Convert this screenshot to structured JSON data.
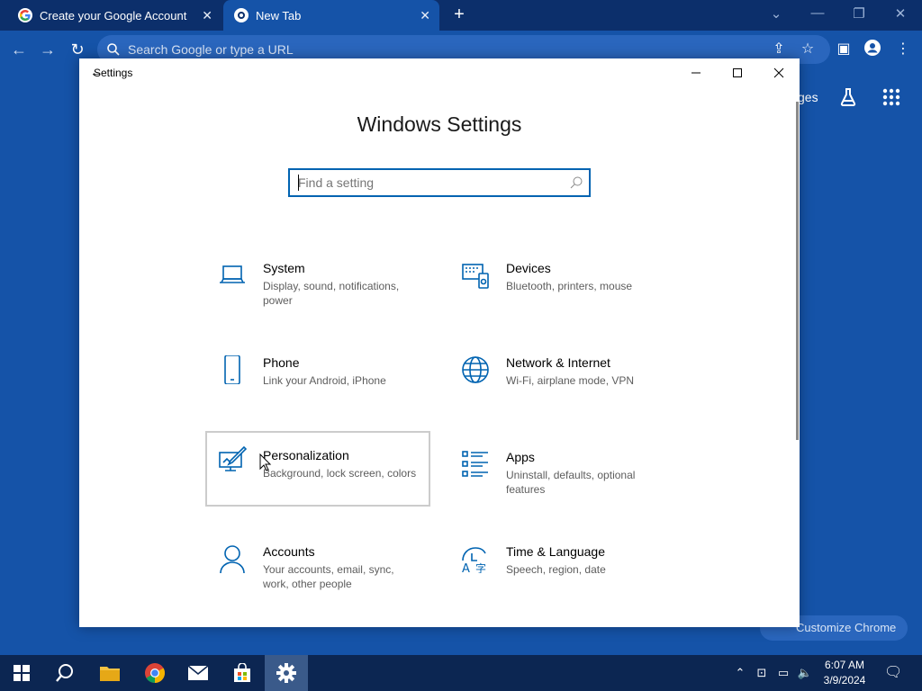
{
  "browser": {
    "tabs": [
      {
        "title": "Create your Google Account"
      },
      {
        "title": "New Tab"
      }
    ],
    "omnibox_placeholder": "Search Google or type a URL",
    "ntp": {
      "images_link": "ges",
      "customize_label": "Customize Chrome"
    }
  },
  "settings": {
    "window_title": "Settings",
    "heading": "Windows Settings",
    "search_placeholder": "Find a setting",
    "tiles": [
      {
        "name": "System",
        "desc": "Display, sound, notifications, power",
        "icon": "laptop-icon"
      },
      {
        "name": "Devices",
        "desc": "Bluetooth, printers, mouse",
        "icon": "devices-icon"
      },
      {
        "name": "Phone",
        "desc": "Link your Android, iPhone",
        "icon": "phone-icon"
      },
      {
        "name": "Network & Internet",
        "desc": "Wi-Fi, airplane mode, VPN",
        "icon": "globe-icon"
      },
      {
        "name": "Personalization",
        "desc": "Background, lock screen, colors",
        "icon": "paint-icon"
      },
      {
        "name": "Apps",
        "desc": "Uninstall, defaults, optional features",
        "icon": "apps-list-icon"
      },
      {
        "name": "Accounts",
        "desc": "Your accounts, email, sync, work, other people",
        "icon": "person-icon"
      },
      {
        "name": "Time & Language",
        "desc": "Speech, region, date",
        "icon": "time-language-icon"
      }
    ]
  },
  "taskbar": {
    "time": "6:07 AM",
    "date": "3/9/2024"
  },
  "colors": {
    "accent": "#0063b1",
    "desktop_blue": "#1553a8",
    "taskbar": "#0c2652"
  }
}
